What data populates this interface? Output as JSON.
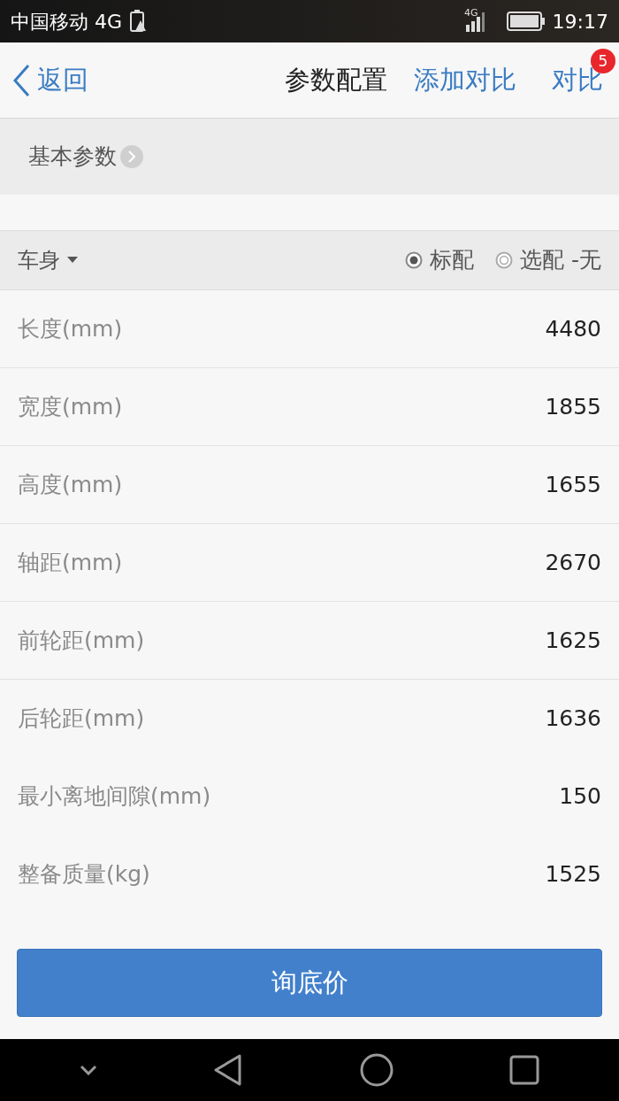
{
  "status_bar": {
    "carrier": "中国移动 4G",
    "network": "4G",
    "time": "19:17"
  },
  "header": {
    "back": "返回",
    "title": "参数配置",
    "add_compare": "添加对比",
    "compare": "对比",
    "compare_count": "5"
  },
  "section_tab": {
    "label": "基本参数"
  },
  "group": {
    "title": "车身",
    "options": [
      {
        "label": "标配",
        "selected": true
      },
      {
        "label": "选配",
        "selected": false
      }
    ],
    "suffix": "-无"
  },
  "rows": [
    {
      "label": "长度(mm)",
      "value": "4480",
      "divider": true
    },
    {
      "label": "宽度(mm)",
      "value": "1855",
      "divider": true
    },
    {
      "label": "高度(mm)",
      "value": "1655",
      "divider": true
    },
    {
      "label": "轴距(mm)",
      "value": "2670",
      "divider": true
    },
    {
      "label": "前轮距(mm)",
      "value": "1625",
      "divider": true
    },
    {
      "label": "后轮距(mm)",
      "value": "1636",
      "divider": false
    },
    {
      "label": "最小离地间隙(mm)",
      "value": "150",
      "divider": false
    },
    {
      "label": "整备质量(kg)",
      "value": "1525",
      "divider": false
    }
  ],
  "action_button": "询底价"
}
